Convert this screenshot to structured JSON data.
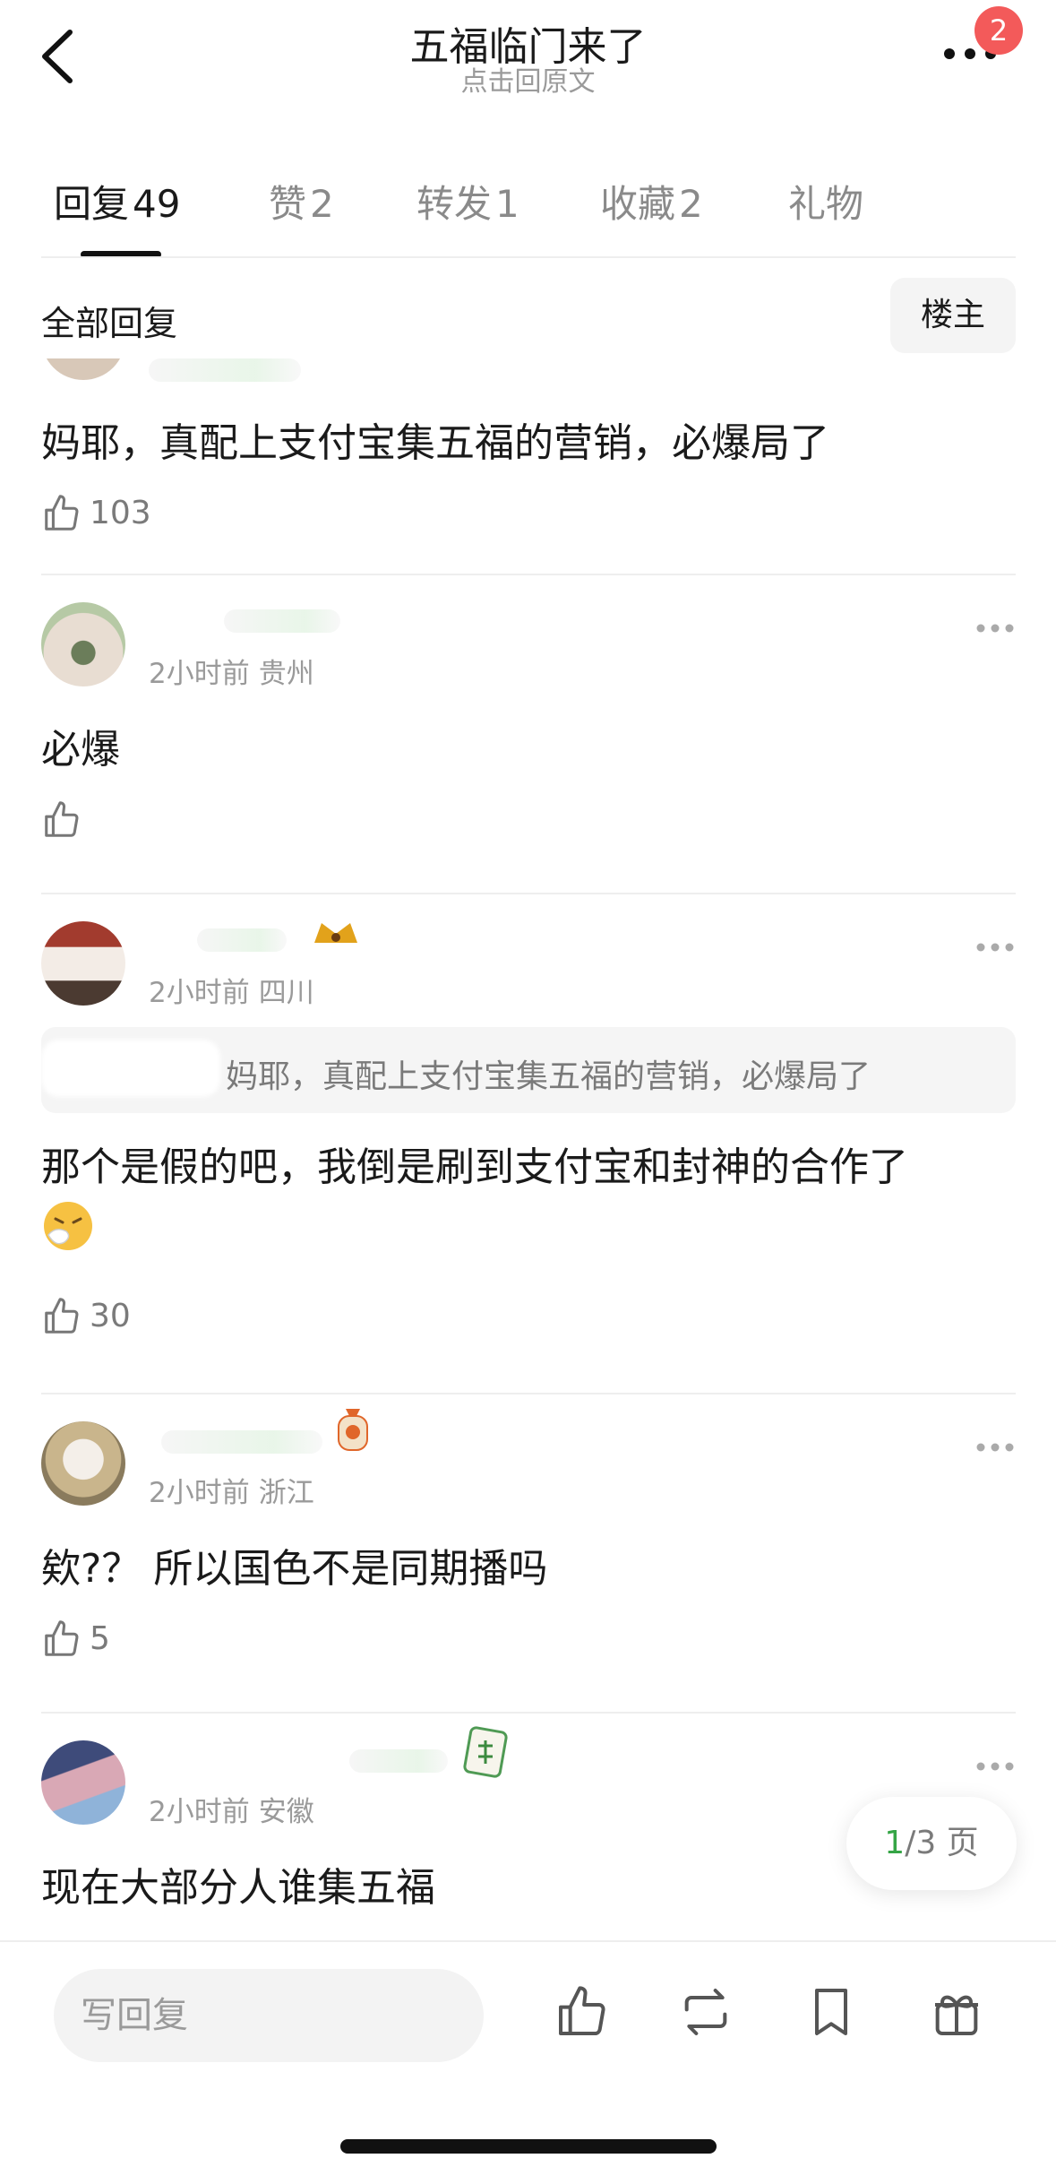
{
  "header": {
    "title": "五福临门来了",
    "subtitle": "点击回原文",
    "notification_count": "2"
  },
  "tabs": [
    {
      "name": "回复",
      "count": "49",
      "active": true
    },
    {
      "name": "赞",
      "count": "2",
      "active": false
    },
    {
      "name": "转发",
      "count": "1",
      "active": false
    },
    {
      "name": "收藏",
      "count": "2",
      "active": false
    },
    {
      "name": "礼物",
      "count": "",
      "active": false
    }
  ],
  "filter": {
    "label": "全部回复",
    "owner_button": "楼主"
  },
  "comments": [
    {
      "text": "妈耶，真配上支付宝集五福的营销，必爆局了",
      "likes": "103"
    },
    {
      "time": "2小时前",
      "location": "贵州",
      "text": "必爆",
      "likes": ""
    },
    {
      "time": "2小时前",
      "location": "四川",
      "quote": "妈耶，真配上支付宝集五福的营销，必爆局了",
      "text": "那个是假的吧，我倒是刷到支付宝和封神的合作了",
      "likes": "30"
    },
    {
      "time": "2小时前",
      "location": "浙江",
      "text": "欸?？ 所以国色不是同期播吗",
      "likes": "5"
    },
    {
      "time": "2小时前",
      "location": "安徽",
      "text": "现在大部分人谁集五福"
    }
  ],
  "pagination": {
    "current": "1",
    "total_text": "/3 页"
  },
  "bottom_bar": {
    "reply_placeholder": "写回复"
  },
  "colors": {
    "badge": "#f35a5a",
    "page_current": "#35a546",
    "text_primary": "#1a1a1a",
    "text_secondary": "#9a9a9a"
  }
}
